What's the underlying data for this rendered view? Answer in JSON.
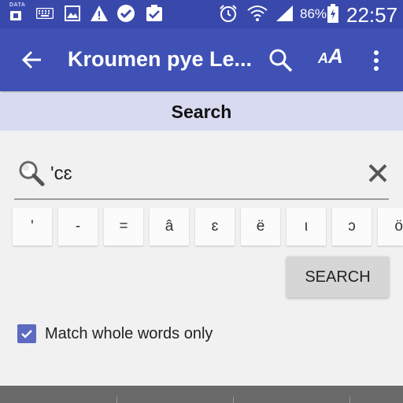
{
  "status_bar": {
    "data_label": "DATA",
    "battery_percent": "86%",
    "time": "22:57",
    "icons": [
      "keyboard-icon",
      "image-icon",
      "warning-icon",
      "check-badge-icon",
      "clipboard-check-icon",
      "alarm-icon",
      "wifi-icon",
      "signal-icon",
      "battery-icon"
    ]
  },
  "app_bar": {
    "title": "Kroumen pye Le...",
    "font_size_label_small": "A",
    "font_size_label_large": "A",
    "icons": [
      "back-arrow-icon",
      "search-icon",
      "font-size-icon",
      "more-vert-icon"
    ],
    "color": "#3f51b5"
  },
  "subheader": {
    "title": "Search"
  },
  "search": {
    "value": "'cɛ",
    "placeholder": ""
  },
  "special_chars": [
    "'",
    "-",
    "=",
    "â",
    "ɛ",
    "ë",
    "ι",
    "ɔ",
    "ö"
  ],
  "search_button": {
    "label": "SEARCH"
  },
  "match_whole_words": {
    "label": "Match whole words only",
    "checked": true
  },
  "colors": {
    "primary": "#3f51b5",
    "status_bar": "#3949ab",
    "subheader_bg": "#d7daf0",
    "checkbox": "#5c6bc0"
  }
}
